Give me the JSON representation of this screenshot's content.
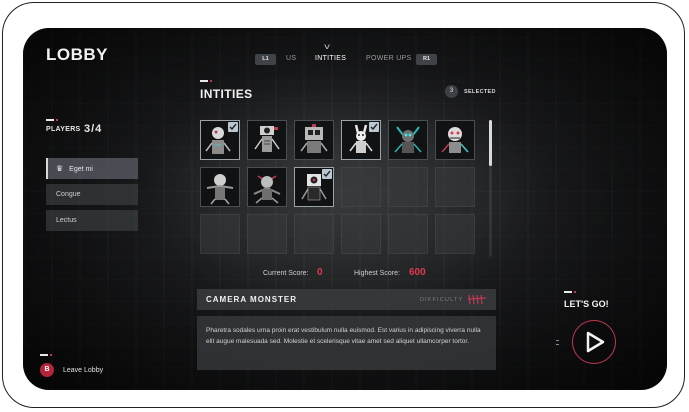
{
  "lobby": {
    "title": "LOBBY"
  },
  "players": {
    "label": "PLAYERS",
    "count": "3/4"
  },
  "sidebar": {
    "items": [
      {
        "label": "Eget mi",
        "active": true,
        "icon": "crown-icon"
      },
      {
        "label": "Congue",
        "active": false
      },
      {
        "label": "Lectus",
        "active": false
      }
    ]
  },
  "leave": {
    "key": "B",
    "label": "Leave Lobby"
  },
  "tabs": {
    "left_key": "L1",
    "right_key": "R1",
    "items": [
      {
        "label": "US",
        "active": false
      },
      {
        "label": "INTITIES",
        "active": true
      },
      {
        "label": "POWER UPS",
        "active": false
      }
    ]
  },
  "section": {
    "title": "INTITIES",
    "selected_count": "3",
    "selected_label": "SELECTED"
  },
  "grid": {
    "cells": [
      {
        "filled": true,
        "checked": true,
        "icon": "monster-1-icon"
      },
      {
        "filled": true,
        "checked": false,
        "icon": "monster-2-icon"
      },
      {
        "filled": true,
        "checked": false,
        "icon": "monster-3-icon"
      },
      {
        "filled": true,
        "checked": true,
        "icon": "monster-4-icon"
      },
      {
        "filled": true,
        "checked": false,
        "icon": "monster-5-icon"
      },
      {
        "filled": true,
        "checked": false,
        "icon": "monster-6-icon"
      },
      {
        "filled": true,
        "checked": false,
        "icon": "monster-7-icon"
      },
      {
        "filled": true,
        "checked": false,
        "icon": "monster-8-icon"
      },
      {
        "filled": true,
        "checked": true,
        "icon": "camera-monster-icon"
      },
      {
        "filled": false
      },
      {
        "filled": false
      },
      {
        "filled": false
      },
      {
        "filled": false
      },
      {
        "filled": false
      },
      {
        "filled": false
      },
      {
        "filled": false
      },
      {
        "filled": false
      },
      {
        "filled": false
      }
    ]
  },
  "scores": {
    "current_label": "Current Score:",
    "current_value": "0",
    "highest_label": "Highest Score:",
    "highest_value": "600"
  },
  "monster": {
    "name": "CAMERA MONSTER",
    "difficulty_label": "DIFFICULTY",
    "description": "Pharetra sodales urna proin erat vestibulum nulla euismod. Est varius in adipiscing viverra nulla elit augue malesuada sed. Molestie et scelerisque vitae amet sed aliquet ullamcorper tortor."
  },
  "cta": {
    "label": "LET'S GO!"
  },
  "colors": {
    "accent": "#c03a52",
    "score": "#e0394f",
    "badge": "#b3263a"
  }
}
